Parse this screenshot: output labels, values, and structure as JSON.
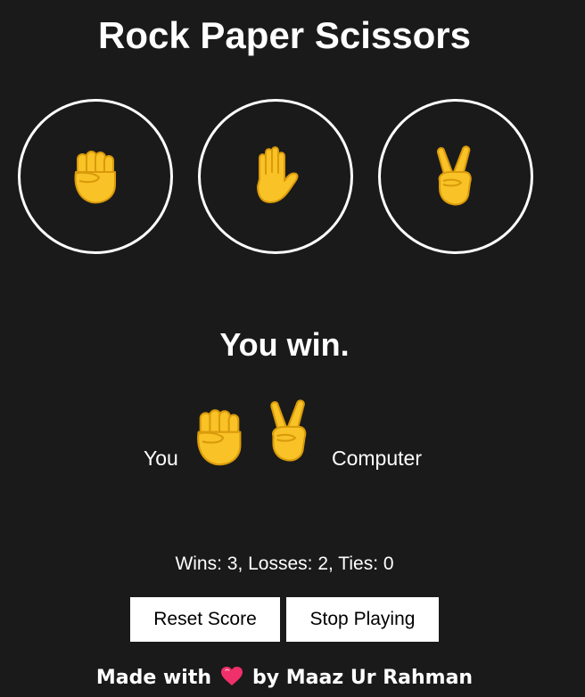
{
  "title": "Rock Paper Scissors",
  "choices": [
    {
      "id": "rock",
      "icon": "rock-fist-icon"
    },
    {
      "id": "paper",
      "icon": "paper-hand-icon"
    },
    {
      "id": "scissors",
      "icon": "scissors-victory-icon"
    }
  ],
  "result": {
    "text": "You win."
  },
  "matchup": {
    "you_label": "You",
    "you_pick_icon": "rock-fist-icon",
    "computer_label": "Computer",
    "computer_pick_icon": "scissors-victory-icon"
  },
  "score": {
    "text": "Wins: 3, Losses: 2, Ties: 0"
  },
  "buttons": {
    "reset_label": "Reset Score",
    "stop_label": "Stop Playing"
  },
  "footer": {
    "prefix": "Made with",
    "heart_icon": "heart-icon",
    "suffix": "by Maaz Ur Rahman"
  },
  "colors": {
    "background": "#1a1a1a",
    "text": "#ffffff",
    "emoji_yellow": "#f9c226",
    "emoji_outline": "#e0a40c",
    "heart": "#f0306a"
  }
}
